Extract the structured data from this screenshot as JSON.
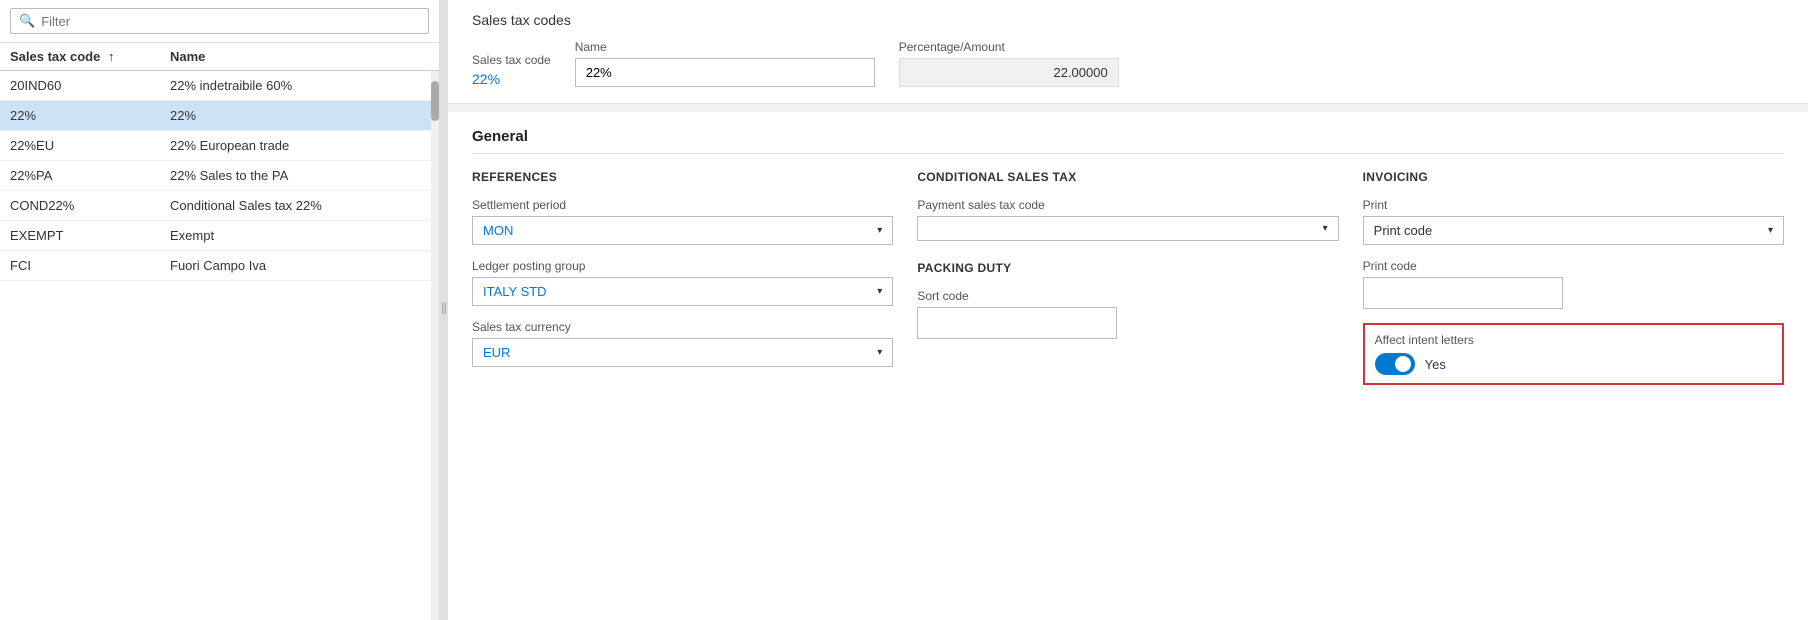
{
  "left": {
    "filter_placeholder": "Filter",
    "table_header": {
      "code_label": "Sales tax code",
      "name_label": "Name",
      "sort_indicator": "↑"
    },
    "rows": [
      {
        "code": "20IND60",
        "name": "22% indetraibile 60%",
        "selected": false
      },
      {
        "code": "22%",
        "name": "22%",
        "selected": true
      },
      {
        "code": "22%EU",
        "name": "22% European trade",
        "selected": false
      },
      {
        "code": "22%PA",
        "name": "22% Sales to the PA",
        "selected": false
      },
      {
        "code": "COND22%",
        "name": "Conditional Sales tax 22%",
        "selected": false
      },
      {
        "code": "EXEMPT",
        "name": "Exempt",
        "selected": false
      },
      {
        "code": "FCI",
        "name": "Fuori Campo Iva",
        "selected": false
      }
    ]
  },
  "right": {
    "page_title": "Sales tax codes",
    "fields": {
      "code_label": "Sales tax code",
      "code_value": "22%",
      "name_label": "Name",
      "name_value": "22%",
      "percentage_label": "Percentage/Amount",
      "percentage_value": "22.00000"
    },
    "general": {
      "title": "General",
      "references": {
        "section_title": "REFERENCES",
        "settlement_label": "Settlement period",
        "settlement_value": "MON",
        "ledger_label": "Ledger posting group",
        "ledger_value": "ITALY STD",
        "currency_label": "Sales tax currency",
        "currency_value": "EUR"
      },
      "conditional": {
        "section_title": "CONDITIONAL SALES TAX",
        "payment_label": "Payment sales tax code",
        "payment_value": "",
        "packing_title": "PACKING DUTY",
        "sort_label": "Sort code",
        "sort_value": ""
      },
      "invoicing": {
        "section_title": "INVOICING",
        "print_label": "Print",
        "print_value": "Print code",
        "print_code_label": "Print code",
        "print_code_value": "",
        "affect_label": "Affect intent letters",
        "affect_value": "Yes",
        "toggle_on": true
      }
    }
  }
}
